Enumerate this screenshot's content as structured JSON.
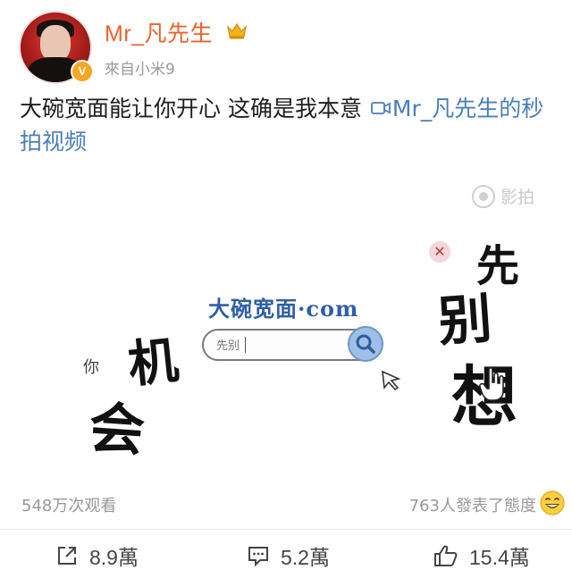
{
  "user": {
    "name": "Mr_凡先生",
    "source": "來自小米9"
  },
  "post": {
    "text": "大碗宽面能让你开心 这确是我本意",
    "video_link": "Mr_凡先生的秒拍视频"
  },
  "video": {
    "watermark": "影拍",
    "site_title": "大碗宽面·com",
    "search_value": "先别",
    "brush_text": {
      "ni": "你",
      "ji": "机",
      "hui": "会",
      "xian": "先",
      "bie": "别",
      "xiang": "想"
    }
  },
  "stats": {
    "views": "548万次观看",
    "reactions": "763人發表了態度"
  },
  "actions": {
    "share": "8.9萬",
    "comment": "5.2萬",
    "like": "15.4萬"
  },
  "colors": {
    "username": "#e8632b",
    "link": "#4a7fb7",
    "badge": "#f6a623",
    "search_button": "#9ec0e8"
  },
  "icons": [
    "crown-icon",
    "verified-icon",
    "video-icon",
    "search-icon",
    "cursor-icon",
    "close-icon",
    "laugh-emoji-icon",
    "share-icon",
    "comment-icon",
    "like-icon"
  ]
}
